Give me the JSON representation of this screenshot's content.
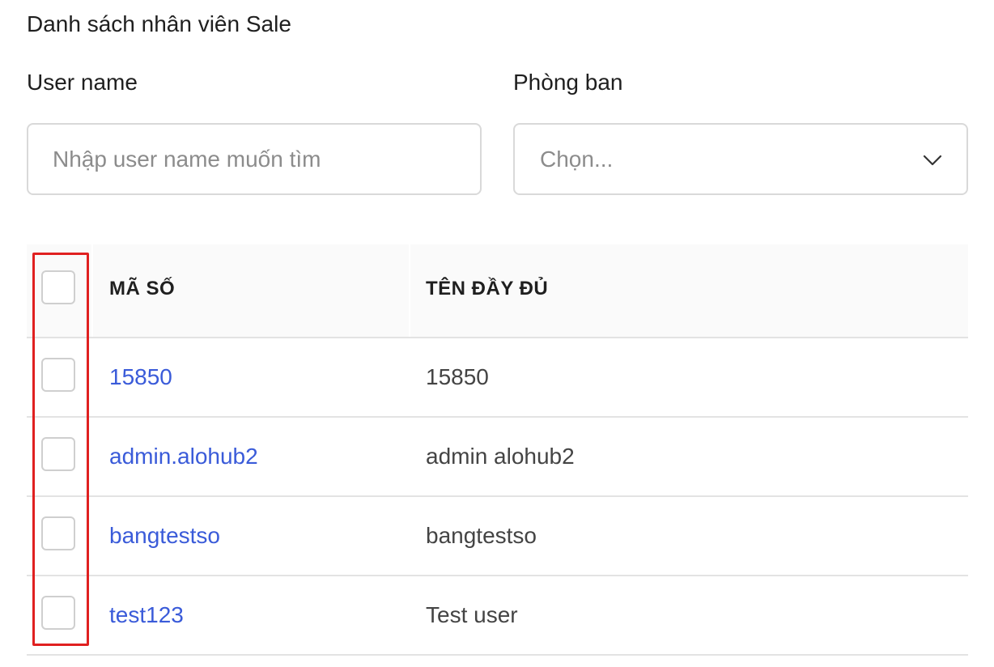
{
  "page": {
    "title": "Danh sách nhân viên Sale"
  },
  "filters": {
    "username_label": "User name",
    "username_placeholder": "Nhập user name muốn tìm",
    "department_label": "Phòng ban",
    "department_value": "Chọn..."
  },
  "table": {
    "columns": [
      "MÃ SỐ",
      "TÊN ĐẦY ĐỦ"
    ],
    "rows": [
      {
        "code": "15850",
        "full_name": "15850"
      },
      {
        "code": "admin.alohub2",
        "full_name": "admin alohub2"
      },
      {
        "code": "bangtestso",
        "full_name": "bangtestso"
      },
      {
        "code": "test123",
        "full_name": "Test user"
      }
    ]
  },
  "colors": {
    "link": "#3a5bd9",
    "highlight": "#e02020",
    "header_bg": "#fafafa",
    "border": "#d9d9d9"
  },
  "icons": {
    "select_arrow": "chevron-down-icon"
  }
}
